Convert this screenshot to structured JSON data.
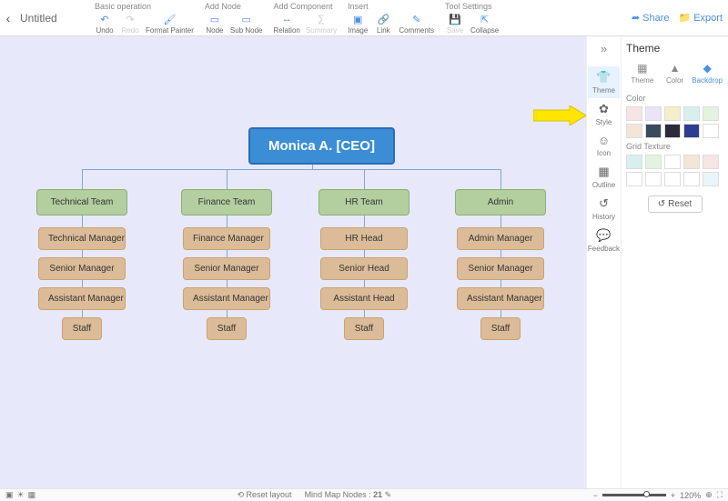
{
  "header": {
    "title": "Untitled",
    "groups": [
      {
        "title": "Basic operation",
        "items": [
          {
            "name": "undo",
            "label": "Undo",
            "icon": "↶",
            "color": "#4a90e2"
          },
          {
            "name": "redo",
            "label": "Redo",
            "icon": "↷",
            "color": "#ccc",
            "disabled": true
          },
          {
            "name": "format-painter",
            "label": "Format Painter",
            "icon": "🖌",
            "color": "#4a90e2"
          }
        ]
      },
      {
        "title": "Add Node",
        "items": [
          {
            "name": "node",
            "label": "Node",
            "icon": "▭",
            "color": "#4a90e2"
          },
          {
            "name": "sub-node",
            "label": "Sub Node",
            "icon": "▭",
            "color": "#4a90e2"
          }
        ]
      },
      {
        "title": "Add Component",
        "items": [
          {
            "name": "relation",
            "label": "Relation",
            "icon": "↔",
            "color": "#4a90e2"
          },
          {
            "name": "summary",
            "label": "Summary",
            "icon": "∑",
            "color": "#ccc",
            "disabled": true
          }
        ]
      },
      {
        "title": "Insert",
        "items": [
          {
            "name": "image",
            "label": "Image",
            "icon": "▣",
            "color": "#4a90e2"
          },
          {
            "name": "link",
            "label": "Link",
            "icon": "🔗",
            "color": "#4a90e2"
          },
          {
            "name": "comments",
            "label": "Comments",
            "icon": "✎",
            "color": "#4a90e2"
          }
        ]
      },
      {
        "title": "Tool Settings",
        "items": [
          {
            "name": "save",
            "label": "Save",
            "icon": "💾",
            "color": "#ccc",
            "disabled": true
          },
          {
            "name": "collapse",
            "label": "Collapse",
            "icon": "⇱",
            "color": "#4a90e2"
          }
        ]
      }
    ],
    "share": "Share",
    "export": "Export"
  },
  "rail": {
    "items": [
      {
        "name": "theme",
        "label": "Theme",
        "icon": "👕",
        "active": true
      },
      {
        "name": "style",
        "label": "Style",
        "icon": "✿"
      },
      {
        "name": "icon",
        "label": "Icon",
        "icon": "☺"
      },
      {
        "name": "outline",
        "label": "Outline",
        "icon": "▦"
      },
      {
        "name": "history",
        "label": "History",
        "icon": "↺"
      },
      {
        "name": "feedback",
        "label": "Feedback",
        "icon": "💬"
      }
    ]
  },
  "panel": {
    "title": "Theme",
    "tabs": [
      {
        "name": "theme",
        "label": "Theme",
        "icon": "▦"
      },
      {
        "name": "color",
        "label": "Color",
        "icon": "▲"
      },
      {
        "name": "backdrop",
        "label": "Backdrop",
        "icon": "◆",
        "active": true
      }
    ],
    "color_label": "Color",
    "color_rows": [
      [
        "#f7e4e4",
        "#e9e4f7",
        "#f4eecb",
        "#d6f0ef",
        "#e3f3df"
      ],
      [
        "#f3e6d6",
        "#3b4a5c",
        "#2b2b3b",
        "#2d3d8f",
        "#ffffff"
      ]
    ],
    "texture_label": "Grid Texture",
    "texture_rows": [
      [
        "#d6f0ef",
        "#e3f3df",
        "#ffffff",
        "#f3e6d6",
        "#f7e4e4"
      ],
      [
        "#ffffff",
        "#ffffff",
        "#ffffff",
        "#ffffff",
        "#eaf4fb"
      ]
    ],
    "reset": "Reset"
  },
  "org": {
    "ceo": "Monica A. [CEO]",
    "teams": [
      {
        "name": "Technical Team",
        "subs": [
          "Technical Manager",
          "Senior Manager",
          "Assistant Manager",
          "Staff"
        ]
      },
      {
        "name": "Finance Team",
        "subs": [
          "Finance Manager",
          "Senior Manager",
          "Assistant Manager",
          "Staff"
        ]
      },
      {
        "name": "HR Team",
        "subs": [
          "HR Head",
          "Senior Head",
          "Assistant Head",
          "Staff"
        ]
      },
      {
        "name": "Admin",
        "subs": [
          "Admin Manager",
          "Senior Manager",
          "Assistant Manager",
          "Staff"
        ]
      }
    ]
  },
  "statusbar": {
    "reset_layout": "Reset layout",
    "nodes_label": "Mind Map Nodes :",
    "nodes_count": "21",
    "zoom": "120%"
  }
}
